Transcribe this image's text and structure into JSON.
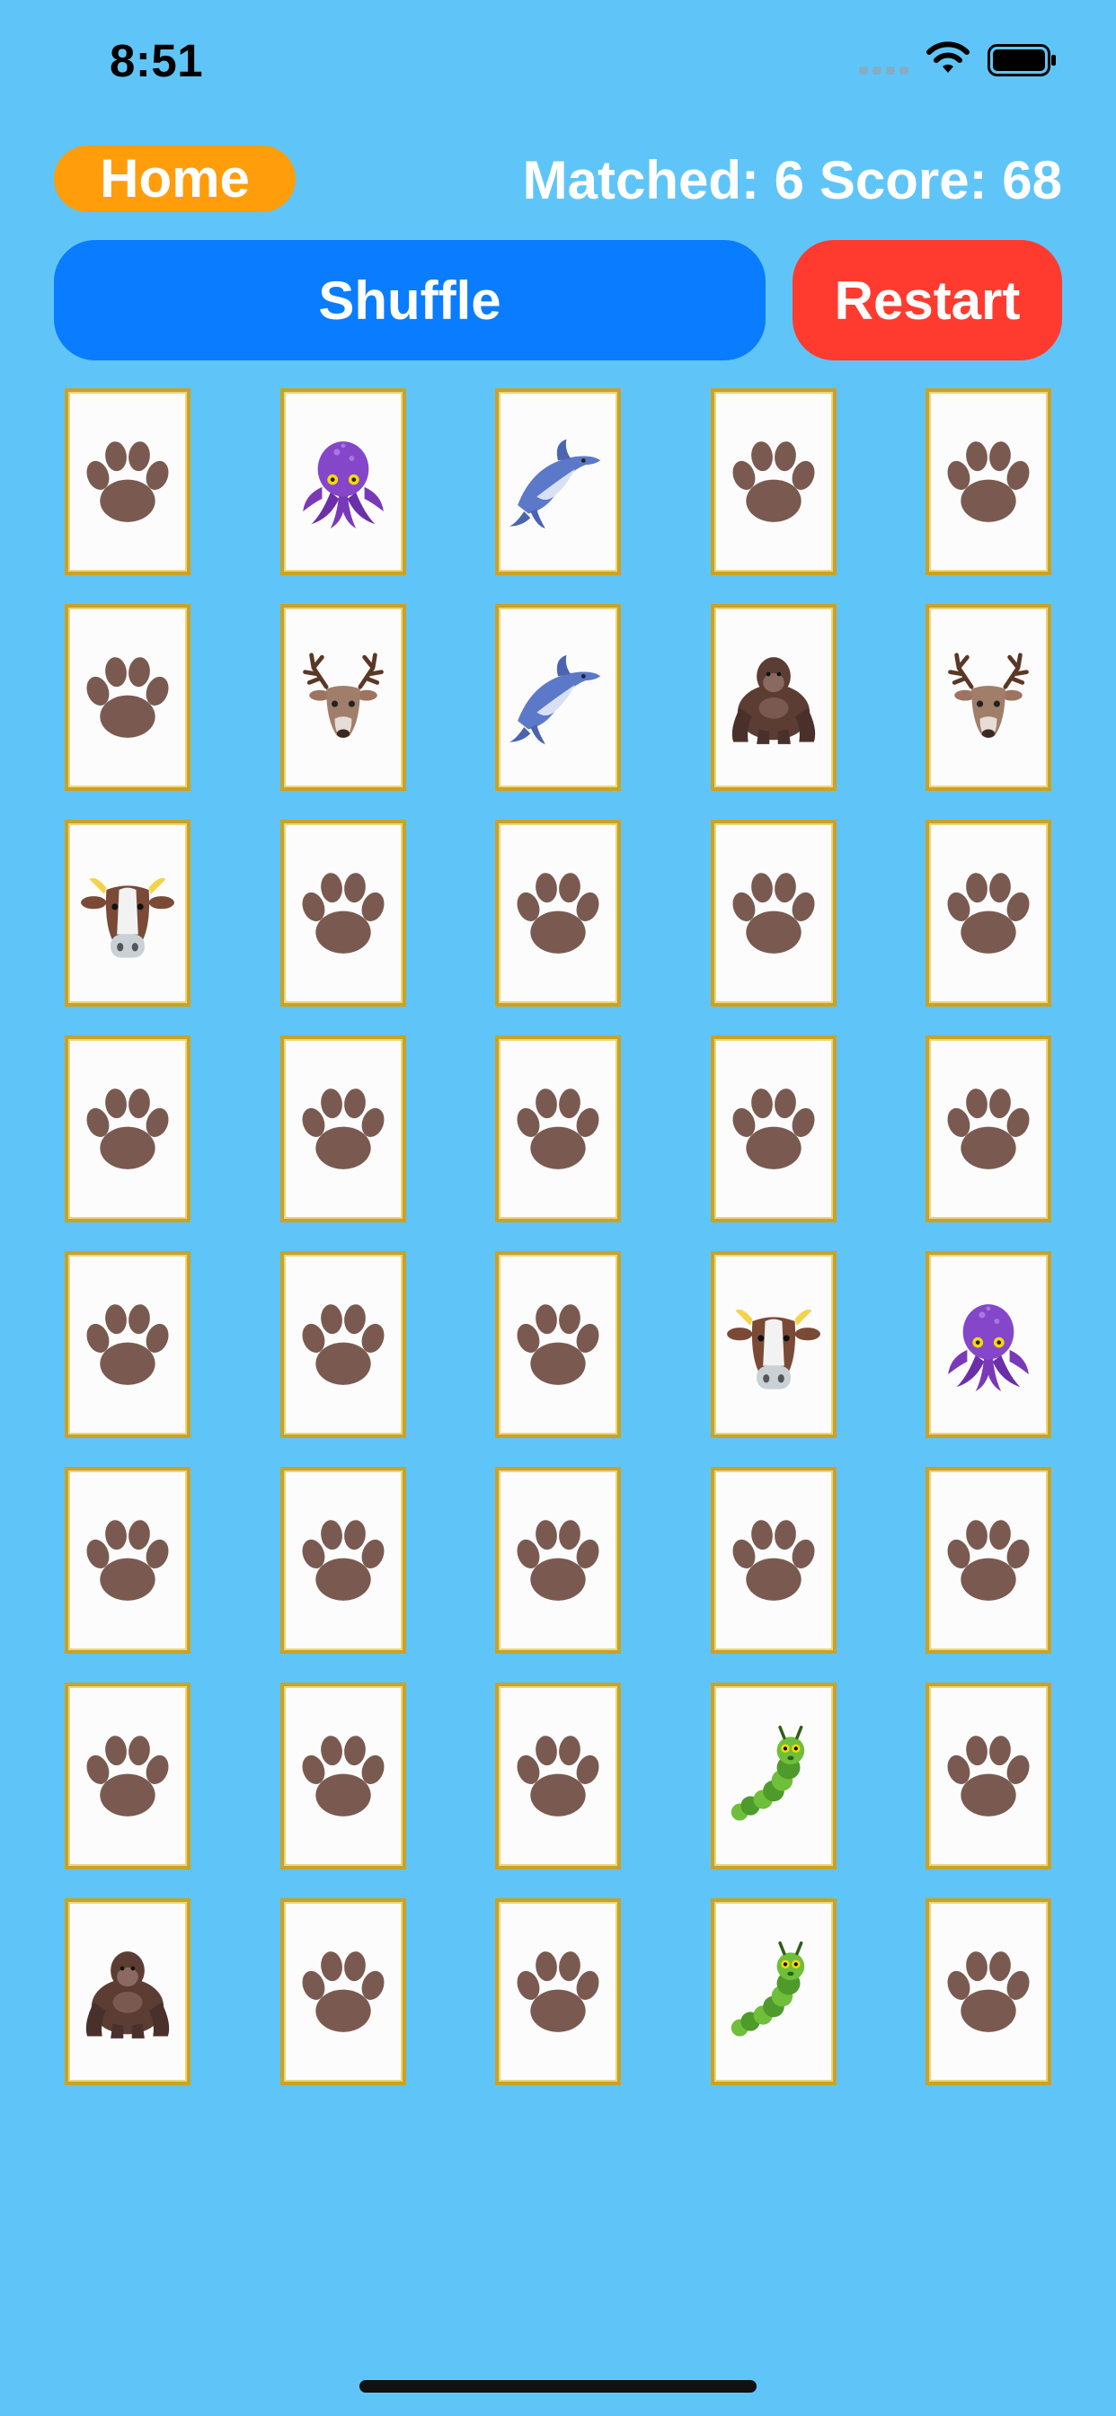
{
  "status_bar": {
    "time": "8:51",
    "icons": [
      "cellular-signal-icon",
      "wifi-icon",
      "battery-icon"
    ]
  },
  "toolbar": {
    "home_label": "Home",
    "matched_text": "Matched: 6",
    "score_text": "Score: 68",
    "shuffle_label": "Shuffle",
    "restart_label": "Restart"
  },
  "colors": {
    "background": "#5FC5F8",
    "home": "#FF9D0A",
    "shuffle": "#0A7CFF",
    "restart": "#FF3B30",
    "card_border": "#C9A227"
  },
  "board": {
    "columns": 5,
    "rows": 8,
    "cards": [
      "paw",
      "octopus",
      "dolphin",
      "paw",
      "paw",
      "paw",
      "deer",
      "dolphin",
      "gorilla",
      "deer",
      "cow",
      "paw",
      "paw",
      "paw",
      "paw",
      "paw",
      "paw",
      "paw",
      "paw",
      "paw",
      "paw",
      "paw",
      "paw",
      "cow",
      "octopus",
      "paw",
      "paw",
      "paw",
      "paw",
      "paw",
      "paw",
      "paw",
      "paw",
      "caterpillar",
      "paw",
      "gorilla",
      "paw",
      "paw",
      "caterpillar",
      "paw"
    ]
  }
}
